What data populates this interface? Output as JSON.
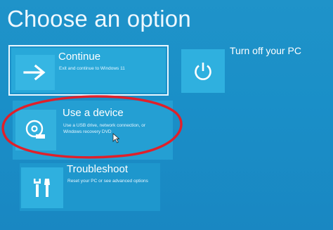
{
  "page_title": "Choose an option",
  "options": [
    {
      "id": "continue",
      "title": "Continue",
      "description": "Exit and continue to Windows 11",
      "icon": "arrow-right-icon"
    },
    {
      "id": "turn_off",
      "title": "Turn off your PC",
      "icon": "power-icon"
    },
    {
      "id": "use_device",
      "title": "Use a device",
      "description_line1": "Use a USB drive, network connection, or",
      "description_line2": "Windows recovery DVD",
      "icon": "disc-drive-icon"
    },
    {
      "id": "troubleshoot",
      "title": "Troubleshoot",
      "description": "Reset your PC or see advanced options",
      "icon": "tools-icon"
    }
  ],
  "colors": {
    "background": "#1a8fc8",
    "tile": "#2fb0df",
    "highlight_outline": "#e0202a"
  }
}
